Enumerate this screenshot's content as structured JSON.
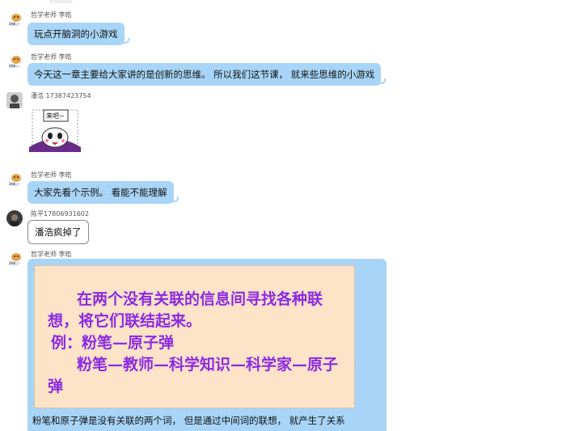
{
  "messages": [
    {
      "sender": "哲学老师 李皓",
      "text": "玩点开脑洞的小游戏"
    },
    {
      "sender": "哲学老师 李皓",
      "text": "今天这一章主要给大家讲的是创新的思维。 所以我们这节课， 就来些思维的小游戏"
    },
    {
      "sender": "潘浩   17387423754",
      "sticker_text": "来吧~"
    },
    {
      "sender": "哲学老师 李皓",
      "text": "大家先看个示例。 看能不能理解"
    },
    {
      "sender": "陈平17806931602",
      "text": "潘浩疯掉了"
    },
    {
      "sender": "哲学老师 李皓",
      "card": {
        "line1": "在两个没有关联的信息间寻找各种联",
        "line2": "想，将它们联结起来。",
        "line3": "例：粉笔—原子弹",
        "line4": "粉笔—教师—科学知识—科学家—原子",
        "line5": "弹"
      },
      "caption": "粉笔和原子弹是没有关联的两个词， 但是通过中间词的联想， 就产生了关系"
    }
  ],
  "colors": {
    "bubble": "#a8d5f7",
    "card_bg": "#fde3c7",
    "card_text": "#8a2be2"
  },
  "icons": {
    "teacher_avatar": "cartoon-avatar-icon",
    "user_avatar": "user-avatar-icon"
  }
}
